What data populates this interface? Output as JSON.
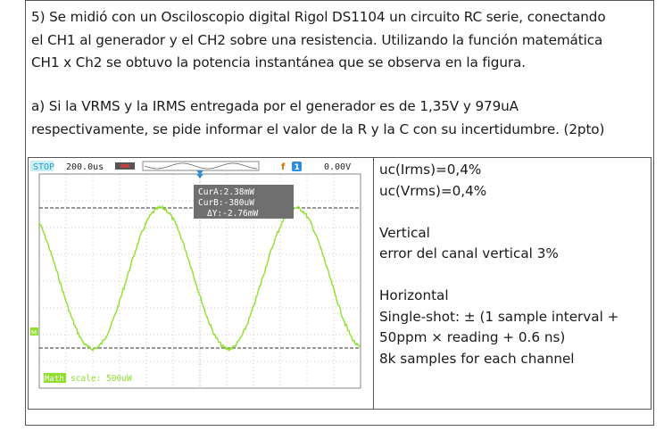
{
  "question": {
    "intro_lines": [
      "5) Se midió con un Osciloscopio digital Rigol DS1104 un circuito RC serie, conectando",
      "el CH1 al generador y el CH2 sobre una resistencia. Utilizando la función matemática",
      "CH1 x Ch2 se obtuvo la potencia instantánea que se observa en la figura."
    ],
    "part_a_lines": [
      "a) Si la VRMS y la IRMS entregada por el generador es de 1,35V y 979uA",
      "respectivamente, se pide informar el valor de la R y la C con su incertidumbre.  (2pto)"
    ]
  },
  "scope": {
    "status": "STOP",
    "timebase": "200.0us",
    "trigger_symbol": "f",
    "trigger_channel": "1",
    "trigger_level": "0.00V",
    "cursor_a": "CurA:2.38mW",
    "cursor_b": "CurB:-380uW",
    "cursor_delta": "ΔY:-2.76mW",
    "math_label": "Math",
    "math_scale": "scale: 500uW",
    "side_marker": "M",
    "colors": {
      "trace": "#8ee02b",
      "grid": "#cfcfcf",
      "status_bg": "#c9eef6",
      "status_text": "#2a9fc4",
      "cursor_box": "#6f6f6f",
      "math_tag": "#8ee02b",
      "trigger_marker": "#2c8de0"
    }
  },
  "specs": {
    "lines": [
      "uc(Irms)=0,4%",
      "uc(Vrms)=0,4%",
      "",
      "Vertical",
      "error del canal vertical 3%",
      "",
      "Horizontal",
      "Single-shot: ± (1 sample interval +",
      "50ppm × reading + 0.6 ns)",
      "8k samples for each channel"
    ]
  }
}
